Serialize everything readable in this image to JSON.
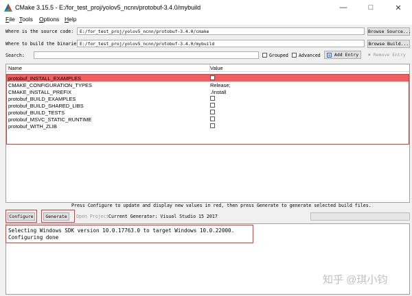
{
  "window": {
    "title": "CMake 3.15.5 - E:/for_test_proj/yolov5_ncnn/protobuf-3.4.0/mybuild"
  },
  "menu": [
    {
      "label": "File",
      "accel": "F",
      "rest": "ile"
    },
    {
      "label": "Tools",
      "accel": "T",
      "rest": "ools"
    },
    {
      "label": "Options",
      "accel": "O",
      "rest": "ptions"
    },
    {
      "label": "Help",
      "accel": "H",
      "rest": "elp"
    }
  ],
  "source": {
    "label": "Where is the source code:",
    "value": "E:/for_test_proj/yolov5_ncnn/protobuf-3.4.0/cmake",
    "browse": "Browse Source..."
  },
  "binaries": {
    "label": "Where to build the binaries:",
    "value": "E:/for_test_proj/yolov5_ncnn/protobuf-3.4.0/mybuild",
    "browse": "Browse Build..."
  },
  "search": {
    "label": "Search:",
    "value": ""
  },
  "options": {
    "grouped": {
      "label": "Grouped",
      "checked": false
    },
    "advanced": {
      "label": "Advanced",
      "checked": false
    },
    "add_entry": "Add Entry",
    "remove_entry": "Remove Entry"
  },
  "table": {
    "headers": {
      "name": "Name",
      "value": "Value"
    },
    "rows": [
      {
        "name": "protobuf_INSTALL_EXAMPLES",
        "type": "bool",
        "checked": false,
        "selected": true
      },
      {
        "name": "CMAKE_CONFIGURATION_TYPES",
        "type": "text",
        "value": "Release;"
      },
      {
        "name": "CMAKE_INSTALL_PREFIX",
        "type": "text",
        "value": "./install"
      },
      {
        "name": "protobuf_BUILD_EXAMPLES",
        "type": "bool",
        "checked": false
      },
      {
        "name": "protobuf_BUILD_SHARED_LIBS",
        "type": "bool",
        "checked": false
      },
      {
        "name": "protobuf_BUILD_TESTS",
        "type": "bool",
        "checked": false
      },
      {
        "name": "protobuf_MSVC_STATIC_RUNTIME",
        "type": "bool",
        "checked": false
      },
      {
        "name": "protobuf_WITH_ZLIB",
        "type": "bool",
        "checked": false
      }
    ]
  },
  "hint": "Press Configure to update and display new values in red, then press Generate to generate selected build files.",
  "actions": {
    "configure": "Configure",
    "generate": "Generate",
    "open_project": "Open Project",
    "current_generator": "Current Generator: Visual Studio 15 2017"
  },
  "output": [
    "Selecting Windows SDK version 10.0.17763.0 to target Windows 10.0.22000.",
    "Configuring done"
  ],
  "watermark": "知乎 @琪小钧",
  "colors": {
    "selected_row": "#f05f5f",
    "annotation_box": "#d23c3c"
  }
}
